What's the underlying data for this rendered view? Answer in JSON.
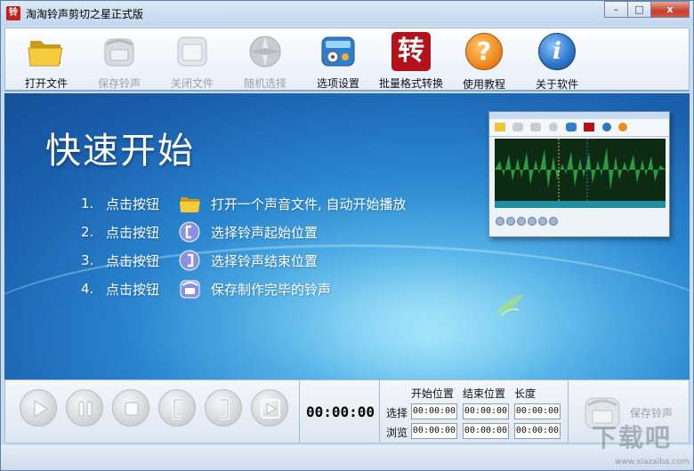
{
  "window": {
    "title": "淘淘铃声剪切之星正式版",
    "app_icon_text": "铃",
    "controls": {
      "minimize": "–",
      "maximize": "□",
      "close": "x"
    }
  },
  "toolbar": {
    "items": [
      {
        "label": "打开文件",
        "icon": "folder-icon",
        "enabled": true
      },
      {
        "label": "保存铃声",
        "icon": "phone-save-icon",
        "enabled": false
      },
      {
        "label": "关闭文件",
        "icon": "close-file-icon",
        "enabled": false
      },
      {
        "label": "随机选择",
        "icon": "random-select-icon",
        "enabled": false
      },
      {
        "label": "选项设置",
        "icon": "settings-icon",
        "enabled": true
      },
      {
        "label": "批量格式转换",
        "icon": "convert-icon",
        "enabled": true,
        "glyph": "转"
      },
      {
        "label": "使用教程",
        "icon": "help-icon",
        "enabled": true,
        "glyph": "?"
      },
      {
        "label": "关于软件",
        "icon": "info-icon",
        "enabled": true,
        "glyph": "i"
      }
    ]
  },
  "main": {
    "heading": "快速开始",
    "steps": [
      {
        "num": "1.",
        "prefix": "点击按钮",
        "icon": "folder-icon",
        "text": "打开一个声音文件, 自动开始播放"
      },
      {
        "num": "2.",
        "prefix": "点击按钮",
        "icon": "start-bracket-icon",
        "text": "选择铃声起始位置"
      },
      {
        "num": "3.",
        "prefix": "点击按钮",
        "icon": "end-bracket-icon",
        "text": "选择铃声结束位置"
      },
      {
        "num": "4.",
        "prefix": "点击按钮",
        "icon": "phone-save-icon",
        "text": "保存制作完毕的铃声"
      }
    ]
  },
  "player": {
    "buttons": [
      "play-button",
      "pause-button",
      "stop-button",
      "set-start-button",
      "set-end-button",
      "play-selection-button"
    ],
    "current_time": "00:00:00",
    "headers": {
      "start": "开始位置",
      "end": "结束位置",
      "length": "长度"
    },
    "rows": [
      {
        "label": "选择",
        "start": "00:00:00",
        "end": "00:00:00",
        "length": "00:00:00"
      },
      {
        "label": "浏览",
        "start": "00:00:00",
        "end": "00:00:00",
        "length": "00:00:00"
      }
    ],
    "save_label": "保存铃声"
  },
  "watermark": {
    "text": "下载吧",
    "url": "www.xiazaiba.com"
  },
  "colors": {
    "accent_blue": "#1a5fae",
    "toolbar_bg": "#f4f7fb",
    "close_red": "#c5402d",
    "convert_red": "#b3121a",
    "help_orange": "#ef8a1f",
    "info_blue": "#2b74c8"
  }
}
